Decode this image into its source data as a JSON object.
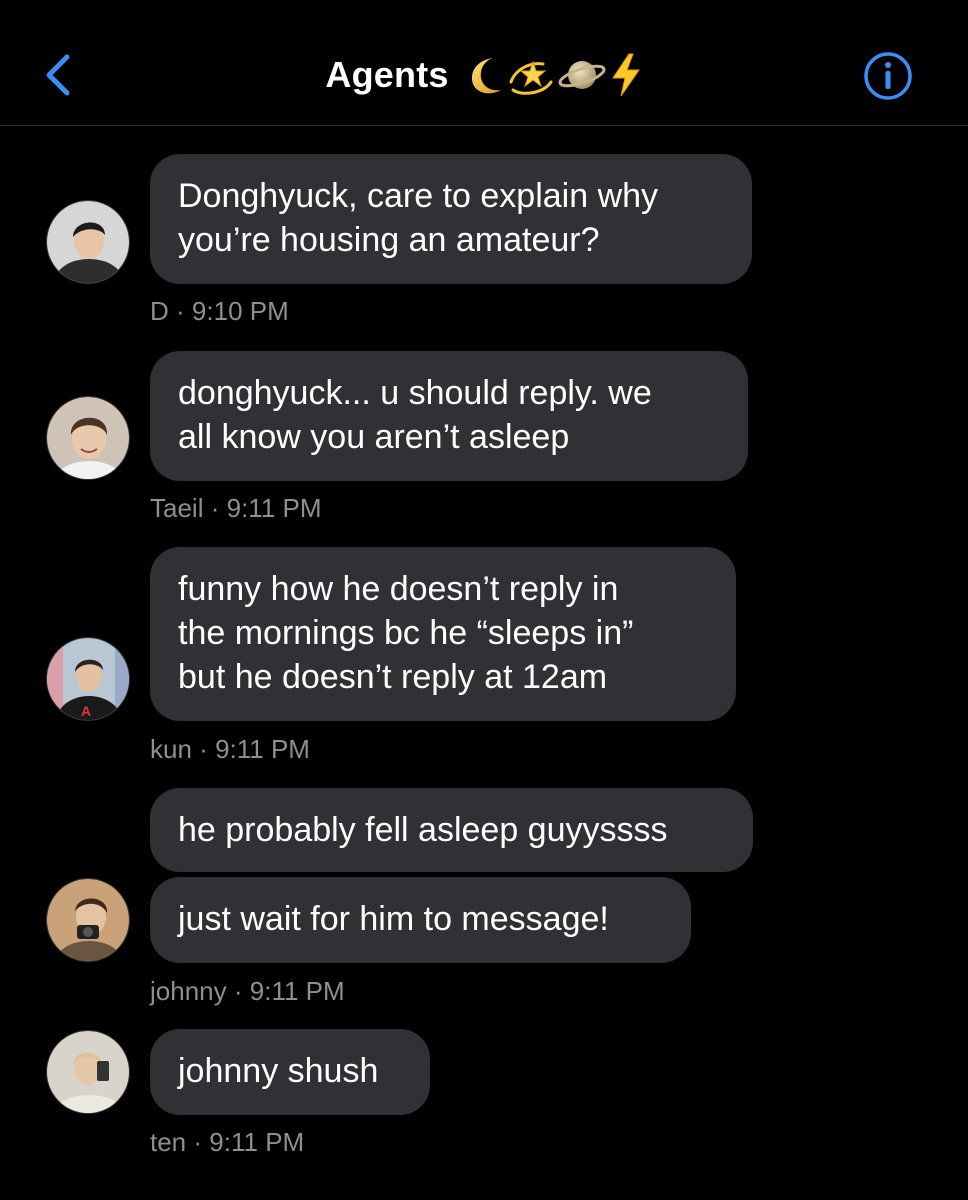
{
  "header": {
    "title": "Agents",
    "emojis": [
      "crescent-moon-icon",
      "dizzy-star-icon",
      "ringed-planet-icon",
      "lightning-bolt-icon"
    ],
    "accent_color": "#3a8ff5"
  },
  "messages": [
    {
      "text": "Donghyuck, care to explain why\nyou’re housing an amateur?",
      "sender": "D",
      "time": "9:10 PM"
    },
    {
      "text": "donghyuck... u should reply. we\nall know you aren’t asleep",
      "sender": "Taeil",
      "time": "9:11 PM"
    },
    {
      "text": "funny how he doesn’t reply in\nthe mornings bc he “sleeps in”\nbut he doesn’t reply at 12am",
      "sender": "kun",
      "time": "9:11 PM"
    },
    {
      "text": "he probably fell asleep guyyssss",
      "text2": "just wait for him to message!",
      "sender": "johnny",
      "time": "9:11 PM"
    },
    {
      "text": "johnny shush",
      "sender": "ten",
      "time": "9:11 PM"
    }
  ],
  "meta_separator": "·",
  "colors": {
    "bubble": "#303134",
    "meta": "#8e8e93",
    "background": "#000000"
  }
}
